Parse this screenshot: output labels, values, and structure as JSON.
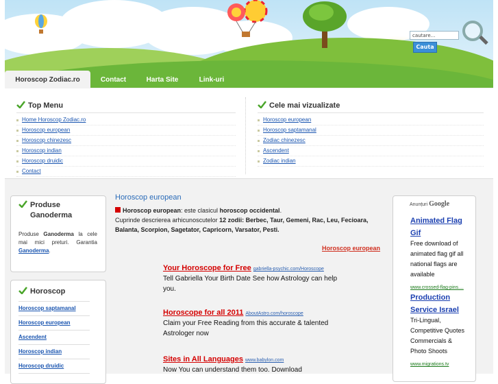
{
  "search": {
    "placeholder": "cautare...",
    "button": "Cauta"
  },
  "nav": {
    "items": [
      "Horoscop Zodiac.ro",
      "Contact",
      "Harta Site",
      "Link-uri"
    ]
  },
  "top_menu": {
    "title": "Top Menu",
    "items": [
      "Home Horoscop Zodiac.ro",
      "Horoscop european",
      "Horoscop chinezesc",
      "Horoscop indian",
      "Horoscop druidic",
      "Contact"
    ]
  },
  "most_viewed": {
    "title": "Cele mai vizualizate",
    "items": [
      "Horoscop european",
      "Horoscop saptamanal",
      "Zodiac chinezesc",
      "Ascendent",
      "Zodiac indian"
    ]
  },
  "box_ganoderma": {
    "title_line1": "Produse",
    "title_line2": "Ganoderma",
    "text_pre": "Produse ",
    "text_bold": "Ganoderma",
    "text_mid": " la cele mai mici preturi. Garantia ",
    "text_link": "Ganoderma",
    "text_end": "."
  },
  "box_horoscop": {
    "title": "Horoscop",
    "items": [
      "Horoscop saptamanal",
      "Horoscop european",
      "Ascendent",
      "Horoscop indian",
      "Horoscop druidic"
    ]
  },
  "main": {
    "title": "Horoscop european",
    "intro_bold1": "Horoscop european",
    "intro_mid": ": este clasicul ",
    "intro_bold2": "horoscop occidental",
    "intro_end": ".",
    "line2_pre": "Cuprinde descrierea arhicunoscutelor ",
    "line2_bold": "12 zodii: Berbec, Taur, Gemeni, Rac, Leu, Fecioara, Balanta, Scorpion, Sagetator, Capricorn, Varsator, Pesti.",
    "more_link": "Horoscop european"
  },
  "ads": [
    {
      "title": "Your Horoscope for Free",
      "url": "gabriella-psychic.com/Horoscope",
      "text": "Tell Gabriella Your Birth Date See how Astrology can help you."
    },
    {
      "title": "Horoscope for all 2011",
      "url": "AboutAstro.com/horoscope",
      "text": "Claim your Free Reading from this accurate & talented Astrologer now"
    },
    {
      "title": "Sites in All Languages",
      "url": "www.babylon.com",
      "text": "Now You can understand them too. Download"
    }
  ],
  "google_ads": {
    "header": "Anunțuri",
    "logo": "Google",
    "items": [
      {
        "title": "Animated Flag Gif",
        "text": "Free download of animated flag gif all national flags are available",
        "url": "www.crossed-flag-pins...."
      },
      {
        "title": "Production Service Israel",
        "text": "Tri-Lingual, Competitive Quotes Commercials & Photo Shoots",
        "url": "www.migrations.tv"
      }
    ]
  },
  "colors": {
    "nav_green": "#6bb63a",
    "link_blue": "#1a55b0",
    "ad_red": "#d40000",
    "title_blue": "#2a6bb8"
  }
}
